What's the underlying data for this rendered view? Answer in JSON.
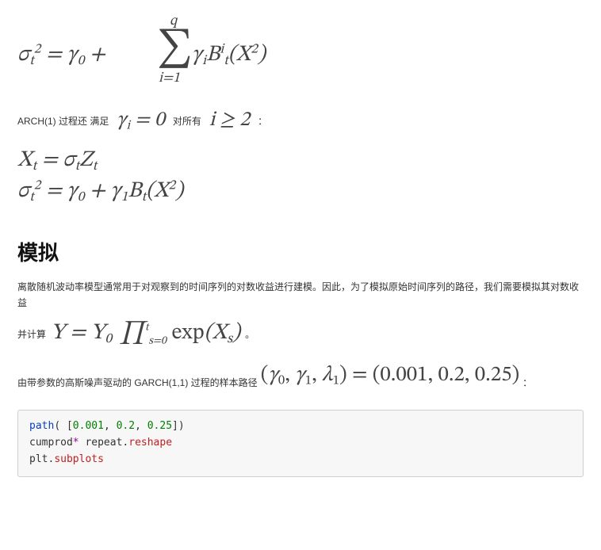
{
  "eq1": {
    "lhs": "σ",
    "lhs_sub": "t",
    "lhs_sup": "2",
    "eq": " = ",
    "g0": "γ",
    "g0_sub": "0",
    "plus": " + ",
    "sum_top": "q",
    "sum_bot_var": "i",
    "sum_bot_eq": "=1",
    "gi": "γ",
    "gi_sub": "i",
    "B": "B",
    "B_sub": "t",
    "B_sup": "i",
    "lp": "(",
    "X": "X",
    "X_sup": "2",
    "rp": ")"
  },
  "arch_line": {
    "prefix": "ARCH(1) 过程还 满足",
    "g": "γ",
    "g_sub": "i",
    "eq0": " = 0",
    "mid": "对所有",
    "i": "i",
    "ge": " ≥ 2",
    "suffix": "："
  },
  "eq2a": {
    "X": "X",
    "X_sub": "t",
    "eq": " = ",
    "sig": "σ",
    "sig_sub": "t",
    "Z": "Z",
    "Z_sub": "t"
  },
  "eq2b": {
    "sig": "σ",
    "sig_sub": "t",
    "sig_sup": "2",
    "eq": " = ",
    "g0": "γ",
    "g0_sub": "0",
    "plus": " + ",
    "g1": "γ",
    "g1_sub": "1",
    "B": "B",
    "B_sub": "t",
    "lp": "(",
    "X": "X",
    "X_sup": "2",
    "rp": ")"
  },
  "heading_sim": "模拟",
  "para1": "离散随机波动率模型通常用于对观察到的时间序列的对数收益进行建模。因此，为了模拟原始时间序列的路径，我们需要模拟其对数收益",
  "eqY": {
    "prefix": "并计算",
    "Y": "Y",
    "eq": " = ",
    "Y0": "Y",
    "Y0_sub": "0",
    "prod_bot_s": "s",
    "prod_bot_eq": "=0",
    "prod_top": "t",
    "exp": " exp",
    "lp": "(",
    "X": "X",
    "X_sub": "s",
    "rp": ")",
    "suffix": "。"
  },
  "sample_line": {
    "prefix": "由带参数的高斯噪声驱动的 GARCH(1,1) 过程的样本路径",
    "lp": "(",
    "g0": "γ",
    "g0_sub": "0",
    "c1": ", ",
    "g1": "γ",
    "g1_sub": "1",
    "c2": ", ",
    "l1": "λ",
    "l1_sub": "1",
    "rp": ")",
    "eq": " = (0.001, 0.2, 0.25)",
    "suffix": "："
  },
  "code": {
    "fn": "path",
    "args_open": "( [",
    "n1": "0.001",
    "sep1": ", ",
    "n2": "0.2",
    "sep2": ", ",
    "n3": "0.25",
    "args_close": "])",
    "line2a": "cumprod",
    "line2op": "*",
    "line2b": " repeat",
    "line2dot": ".",
    "line2attr": "reshape",
    "line3a": "plt",
    "line3dot": ".",
    "line3attr": "subplots"
  }
}
